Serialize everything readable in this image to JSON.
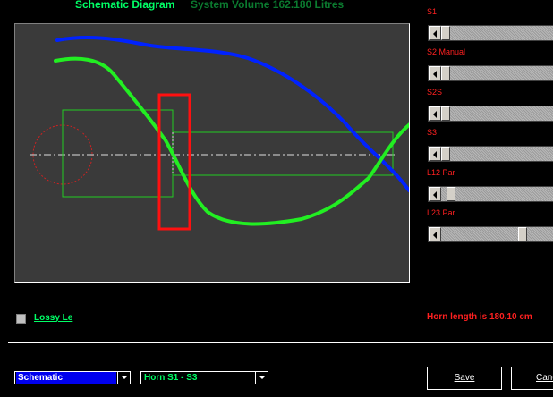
{
  "header": {
    "title": "Schematic Diagram",
    "volume_text": "System Volume 162.180 Litres"
  },
  "sliders": [
    {
      "label": "S1",
      "value": 0.0
    },
    {
      "label": "S2 Manual",
      "value": 0.0
    },
    {
      "label": "S2S",
      "value": 0.0
    },
    {
      "label": "S3",
      "value": 0.0
    },
    {
      "label": "L12 Par",
      "value": 0.05
    },
    {
      "label": "L23 Par",
      "value": 0.75
    }
  ],
  "options": {
    "lossy_label": "Lossy Le",
    "lossy_checked": false
  },
  "status": {
    "horn_length": "Horn length is 180.10 cm"
  },
  "footer": {
    "view_select": "Schematic",
    "horn_select": "Horn S1 - S3",
    "save_label": "Save",
    "cancel_label": "Canc"
  },
  "colors": {
    "background": "#000000",
    "panel": "#3a3a3a",
    "horn_outline": "#22cc22",
    "blue_curve": "#0022ff",
    "green_curve": "#22ee22",
    "marker": "#ff1010",
    "label_red": "#ff2020"
  }
}
